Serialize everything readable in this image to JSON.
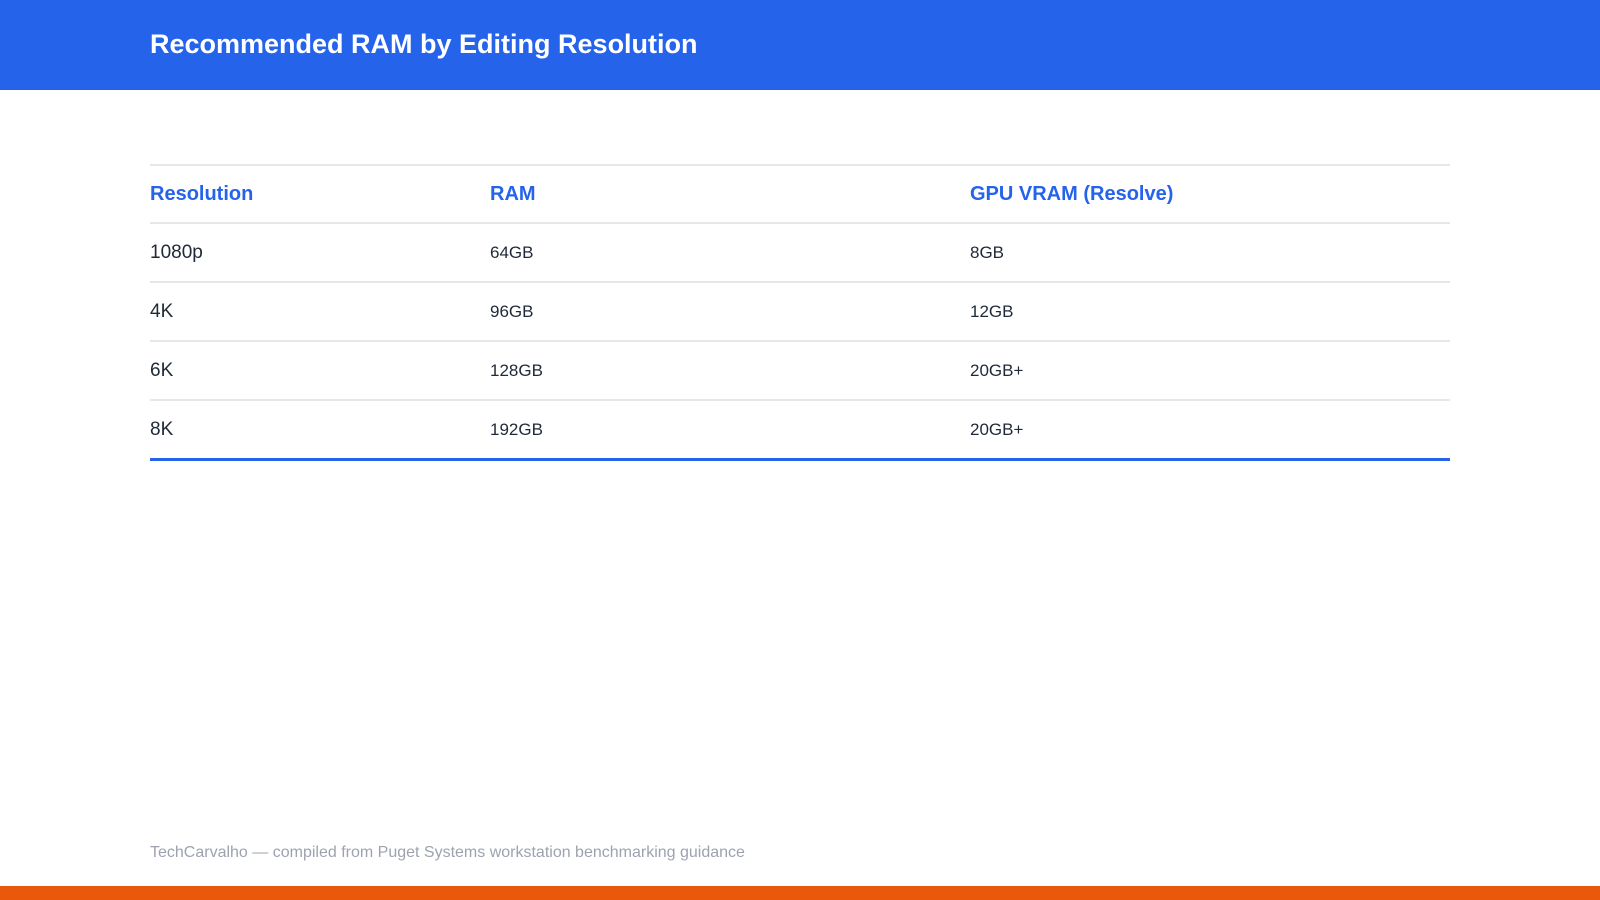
{
  "header": {
    "title": "Recommended RAM by Editing Resolution",
    "background_color": "#2563eb"
  },
  "table": {
    "columns": [
      "Resolution",
      "RAM",
      "GPU VRAM (Resolve)"
    ],
    "rows": [
      [
        "1080p",
        "64GB",
        "8GB"
      ],
      [
        "4K",
        "96GB",
        "12GB"
      ],
      [
        "6K",
        "128GB",
        "20GB+"
      ],
      [
        "8K",
        "192GB",
        "20GB+"
      ]
    ],
    "accent_color": "#2563eb"
  },
  "footer": {
    "note": "TechCarvalho — compiled from Puget Systems workstation benchmarking guidance",
    "bar_color": "#ea580c"
  }
}
